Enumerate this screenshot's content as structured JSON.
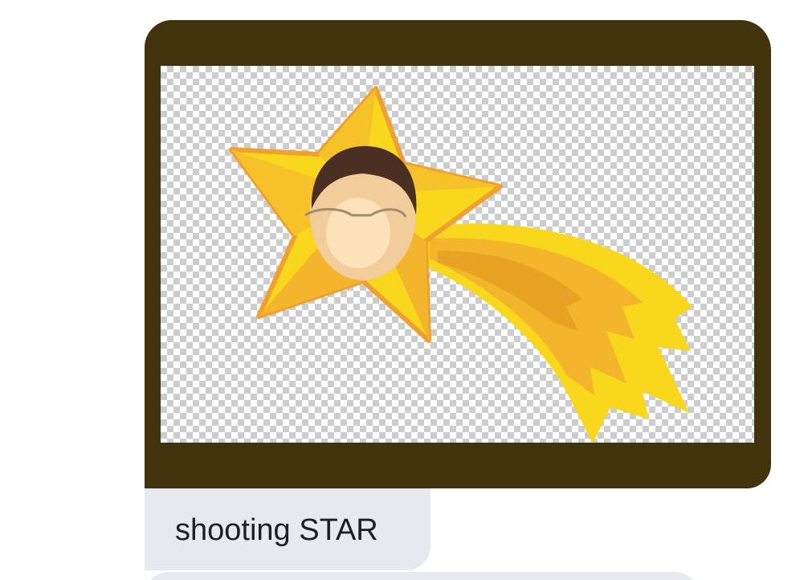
{
  "message": {
    "caption": "shooting STAR"
  },
  "media": {
    "icon": "shooting-star-icon",
    "background": "transparency-checkerboard",
    "frame_color": "#41330c",
    "star_color": "#f9d71c",
    "star_outline_color": "#f0a030",
    "tail_color": "#f9d71c"
  },
  "colors": {
    "caption_bubble": "#e6e9ed",
    "caption_text": "#1f1f23"
  }
}
